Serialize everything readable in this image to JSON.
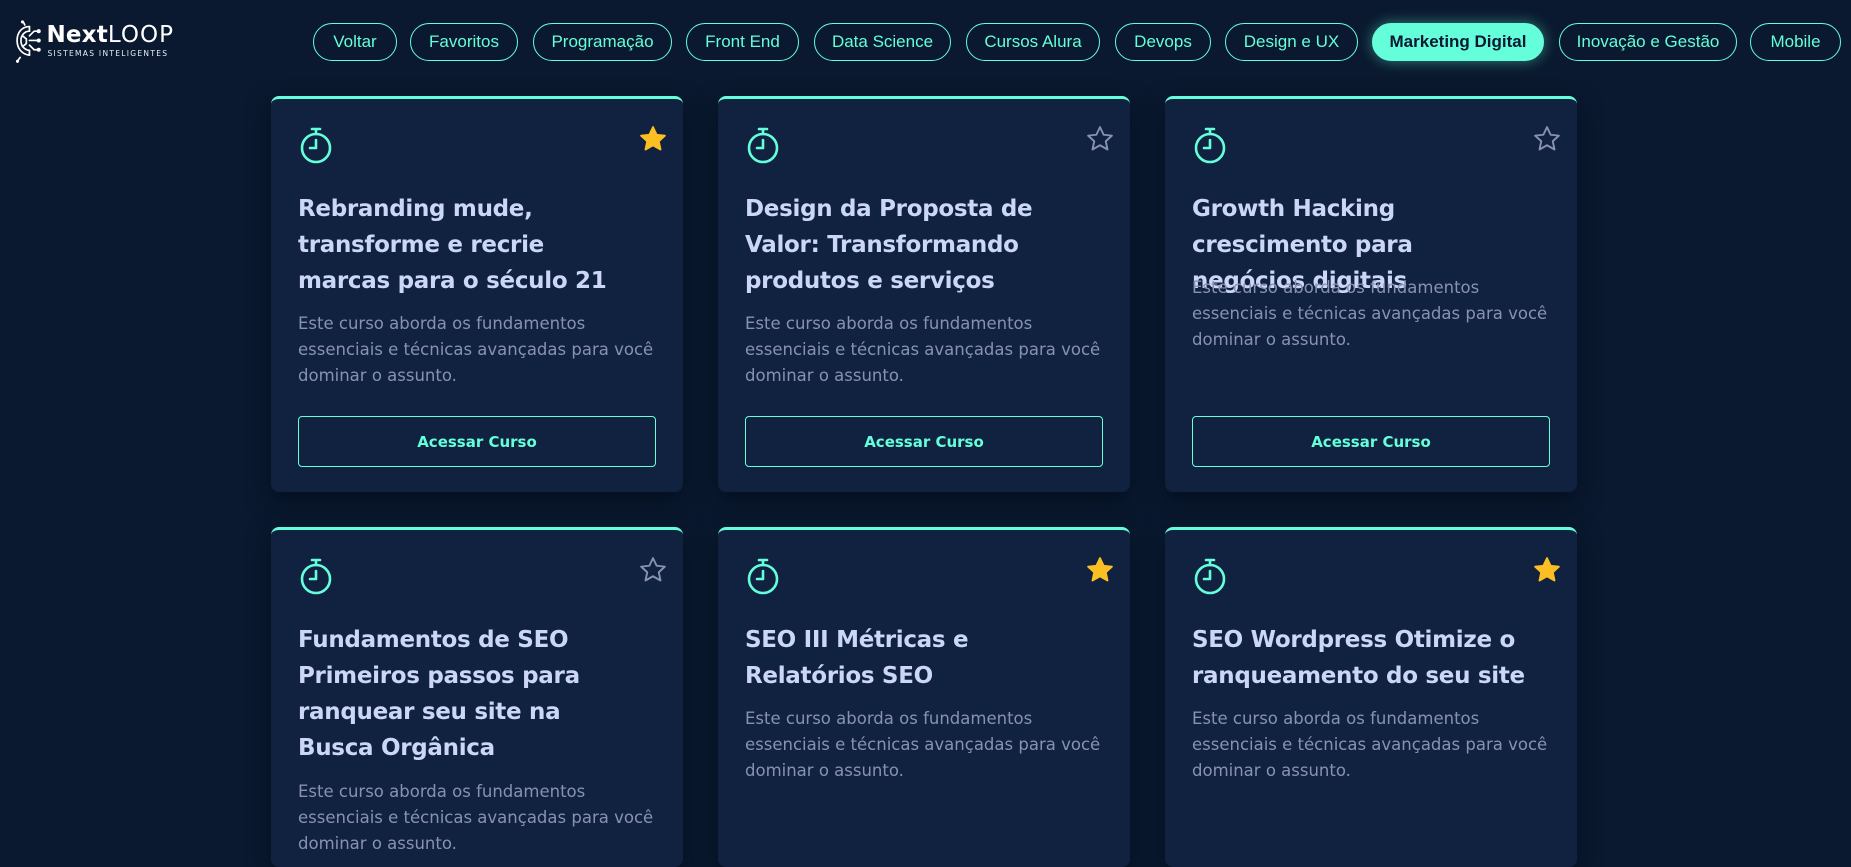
{
  "brand": {
    "name_part1": "Next",
    "name_part2": "Loop",
    "tagline": "SISTEMAS INTELIGENTES"
  },
  "nav": {
    "items": [
      {
        "label": "Voltar"
      },
      {
        "label": "Favoritos"
      },
      {
        "label": "Programação"
      },
      {
        "label": "Front End"
      },
      {
        "label": "Data Science"
      },
      {
        "label": "Cursos Alura"
      },
      {
        "label": "Devops"
      },
      {
        "label": "Design e UX"
      },
      {
        "label": "Marketing Digital",
        "active": true
      },
      {
        "label": "Inovação e Gestão"
      },
      {
        "label": "Mobile"
      }
    ]
  },
  "colors": {
    "background": "#0a192f",
    "card": "#112240",
    "accent": "#64ffda",
    "star_filled": "#fbbf24",
    "star_empty": "#8892b0"
  },
  "icons": {
    "timer": "stopwatch-icon",
    "star": "star-icon"
  },
  "courses": [
    {
      "title": "Rebranding mude, transforme e recrie marcas para o século 21",
      "description": "Este curso aborda os fundamentos essenciais e técnicas avançadas para você dominar o assunto.",
      "button": "Acessar Curso",
      "favorite": true
    },
    {
      "title": "Design da Proposta de Valor: Transformando produtos e serviços",
      "description": "Este curso aborda os fundamentos essenciais e técnicas avançadas para você dominar o assunto.",
      "button": "Acessar Curso",
      "favorite": false
    },
    {
      "title": "Growth Hacking crescimento para negócios digitais",
      "description": "Este curso aborda os fundamentos essenciais e técnicas avançadas para você dominar o assunto.",
      "button": "Acessar Curso",
      "favorite": false
    },
    {
      "title": "Fundamentos de SEO Primeiros passos para ranquear seu site na Busca Orgânica",
      "description": "Este curso aborda os fundamentos essenciais e técnicas avançadas para você dominar o assunto.",
      "favorite": false
    },
    {
      "title": "SEO III Métricas e Relatórios SEO",
      "description": "Este curso aborda os fundamentos essenciais e técnicas avançadas para você dominar o assunto.",
      "favorite": true
    },
    {
      "title": "SEO Wordpress Otimize o ranqueamento do seu site",
      "description": "Este curso aborda os fundamentos essenciais e técnicas avançadas para você dominar o assunto.",
      "favorite": true
    }
  ]
}
